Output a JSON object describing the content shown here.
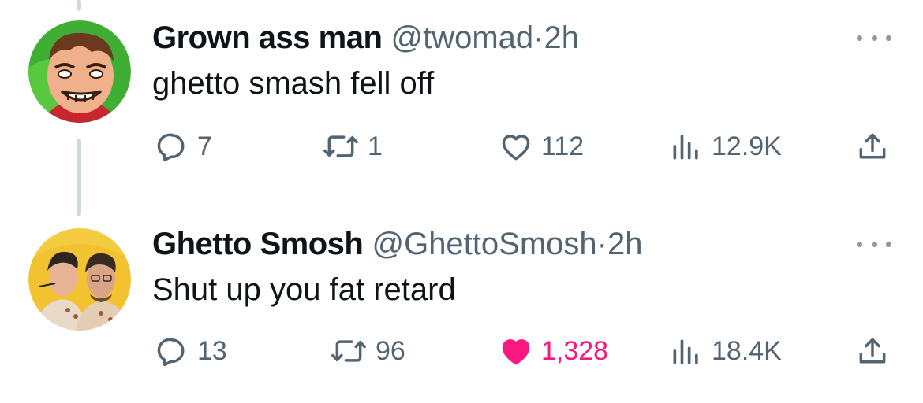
{
  "tweets": [
    {
      "display_name": "Grown ass man",
      "handle": "@twomad",
      "separator": "·",
      "time": "2h",
      "text": "ghetto smash fell off",
      "stats": {
        "replies": "7",
        "reposts": "1",
        "likes": "112",
        "views": "12.9K"
      },
      "liked": false,
      "avatar_icon": "cartoon-grimace-avatar-icon"
    },
    {
      "display_name": "Ghetto Smosh",
      "handle": "@GhettoSmosh",
      "separator": "·",
      "time": "2h",
      "text": "Shut up you fat retard",
      "stats": {
        "replies": "13",
        "reposts": "96",
        "likes": "1,328",
        "views": "18.4K"
      },
      "liked": true,
      "avatar_icon": "two-men-photo-avatar-icon"
    }
  ],
  "colors": {
    "text_primary": "#0f1419",
    "text_secondary": "#536471",
    "like_active": "#f91880",
    "thread_line": "#cfd9de"
  }
}
